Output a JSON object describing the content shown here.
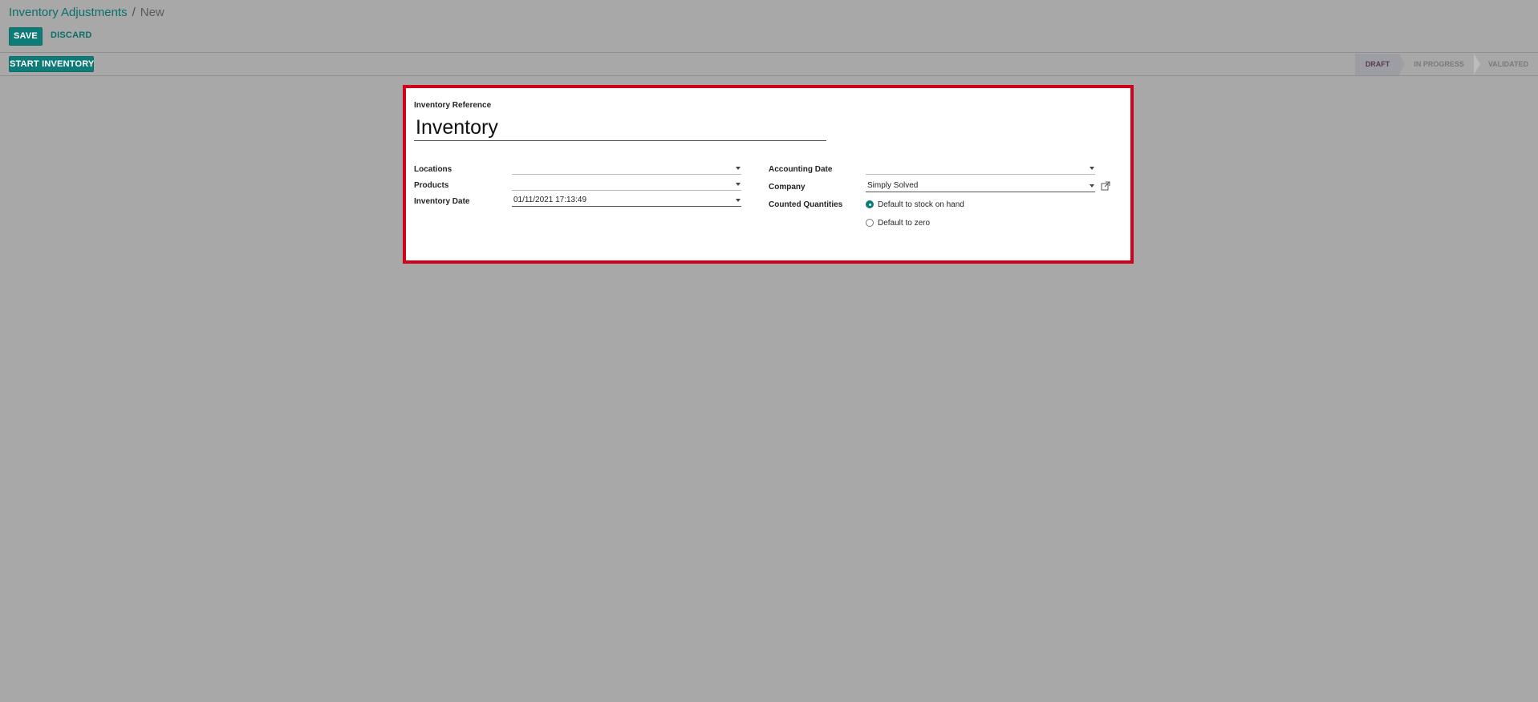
{
  "breadcrumb": {
    "parent": "Inventory Adjustments",
    "separator": "/",
    "current": "New"
  },
  "toolbar": {
    "save_label": "SAVE",
    "discard_label": "DISCARD"
  },
  "statusbar": {
    "start_label": "START INVENTORY",
    "stages": [
      "DRAFT",
      "IN PROGRESS",
      "VALIDATED"
    ],
    "active_stage": "DRAFT"
  },
  "form": {
    "reference_label": "Inventory Reference",
    "reference_value": "Inventory",
    "locations_label": "Locations",
    "locations_value": "",
    "products_label": "Products",
    "products_value": "",
    "inventory_date_label": "Inventory Date",
    "inventory_date_value": "01/11/2021 17:13:49",
    "accounting_date_label": "Accounting Date",
    "accounting_date_value": "",
    "company_label": "Company",
    "company_value": "Simply Solved",
    "counted_label": "Counted Quantities",
    "counted_options": [
      "Default to stock on hand",
      "Default to zero"
    ],
    "counted_selected": "Default to stock on hand"
  },
  "colors": {
    "primary": "#0f7b77",
    "highlight_border": "#d0021b",
    "background": "#a8a8a8"
  }
}
